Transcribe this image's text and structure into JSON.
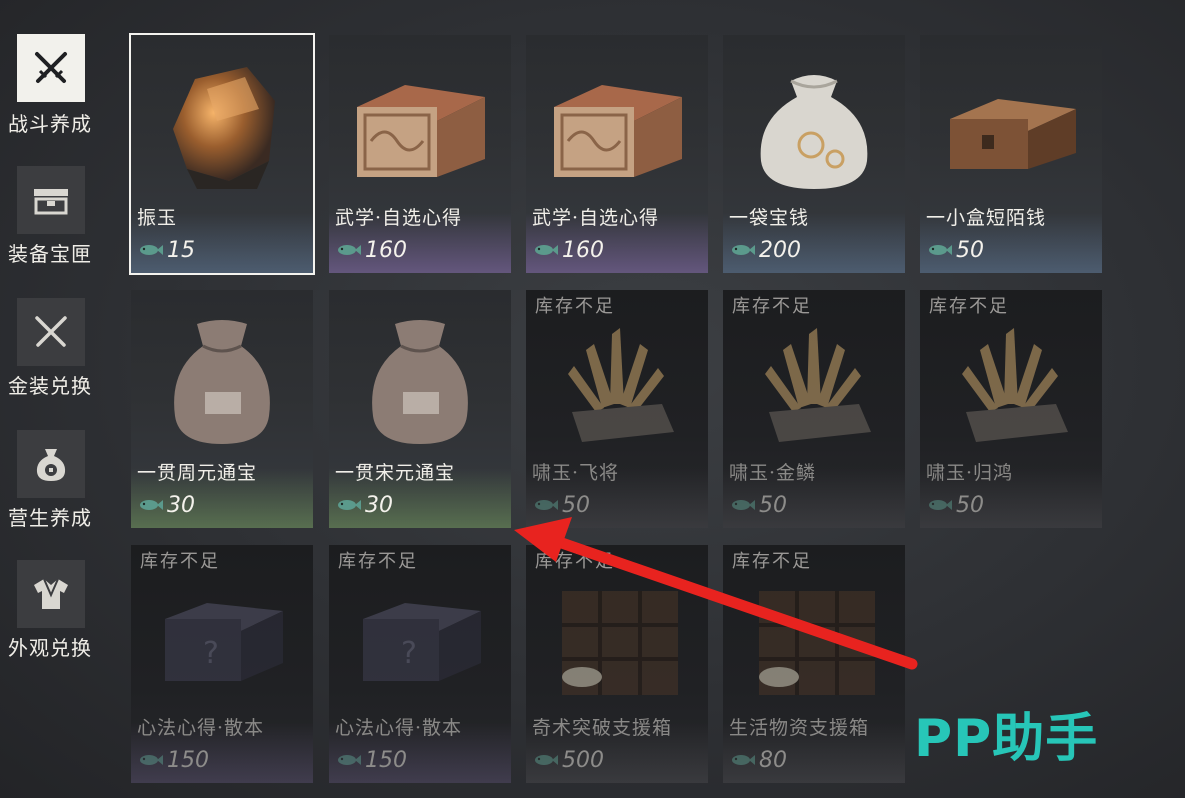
{
  "colors": {
    "accent_red": "#e8231f",
    "watermark_teal": "#27c6b8"
  },
  "sidebar": {
    "items": [
      {
        "label": "战斗养成",
        "icon": "crossed-swords-icon",
        "active": true
      },
      {
        "label": "装备宝匣",
        "icon": "treasure-box-icon",
        "active": false
      },
      {
        "label": "金装兑换",
        "icon": "crossed-swords-icon",
        "active": false
      },
      {
        "label": "营生养成",
        "icon": "money-bag-icon",
        "active": false
      },
      {
        "label": "外观兑换",
        "icon": "robe-icon",
        "active": false
      }
    ]
  },
  "shop": {
    "stock_label": "库存不足",
    "items": [
      {
        "name": "振玉",
        "price": "15",
        "currency_icon": "fish-coin-icon",
        "selected": true,
        "out_of_stock": false,
        "art": "jade-rock"
      },
      {
        "name": "武学·自选心得",
        "price": "160",
        "currency_icon": "fish-coin-icon",
        "selected": false,
        "out_of_stock": false,
        "art": "carved-chest"
      },
      {
        "name": "武学·自选心得",
        "price": "160",
        "currency_icon": "fish-coin-icon",
        "selected": false,
        "out_of_stock": false,
        "art": "carved-chest"
      },
      {
        "name": "一袋宝钱",
        "price": "200",
        "currency_icon": "fish-coin-icon",
        "selected": false,
        "out_of_stock": false,
        "art": "silk-bag"
      },
      {
        "name": "一小盒短陌钱",
        "price": "50",
        "currency_icon": "fish-coin-icon",
        "selected": false,
        "out_of_stock": false,
        "art": "wooden-box"
      },
      {
        "name": "一贯周元通宝",
        "price": "30",
        "currency_icon": "fish-coin-icon",
        "selected": false,
        "out_of_stock": false,
        "art": "coin-sack"
      },
      {
        "name": "一贯宋元通宝",
        "price": "30",
        "currency_icon": "fish-coin-icon",
        "selected": false,
        "out_of_stock": false,
        "art": "coin-sack"
      },
      {
        "name": "啸玉·飞将",
        "price": "50",
        "currency_icon": "fish-coin-icon",
        "selected": false,
        "out_of_stock": true,
        "art": "crystal"
      },
      {
        "name": "啸玉·金鳞",
        "price": "50",
        "currency_icon": "fish-coin-icon",
        "selected": false,
        "out_of_stock": true,
        "art": "crystal"
      },
      {
        "name": "啸玉·归鸿",
        "price": "50",
        "currency_icon": "fish-coin-icon",
        "selected": false,
        "out_of_stock": true,
        "art": "crystal"
      },
      {
        "name": "心法心得·散本",
        "price": "150",
        "currency_icon": "fish-coin-icon",
        "selected": false,
        "out_of_stock": true,
        "art": "dark-chest"
      },
      {
        "name": "心法心得·散本",
        "price": "150",
        "currency_icon": "fish-coin-icon",
        "selected": false,
        "out_of_stock": true,
        "art": "dark-chest"
      },
      {
        "name": "奇术突破支援箱",
        "price": "500",
        "currency_icon": "fish-coin-icon",
        "selected": false,
        "out_of_stock": true,
        "art": "supply-crate"
      },
      {
        "name": "生活物资支援箱",
        "price": "80",
        "currency_icon": "fish-coin-icon",
        "selected": false,
        "out_of_stock": true,
        "art": "supply-crate"
      }
    ]
  },
  "watermark": {
    "text": "PP助手"
  },
  "annotation": {
    "icon": "red-arrow-icon"
  }
}
